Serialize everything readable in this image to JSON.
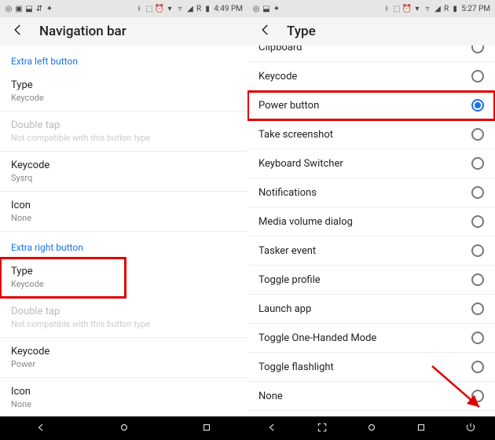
{
  "left": {
    "status": {
      "time": "4:49 PM",
      "net": "R"
    },
    "header_title": "Navigation bar",
    "section_extra_left": "Extra left button",
    "type": {
      "title": "Type",
      "sub": "Keycode"
    },
    "double_tap": {
      "title": "Double tap",
      "sub": "Not compatible with this button type"
    },
    "keycode_left": {
      "title": "Keycode",
      "sub": "Sysrq"
    },
    "icon_left": {
      "title": "Icon",
      "sub": "None"
    },
    "section_extra_right": "Extra right button",
    "type_right": {
      "title": "Type",
      "sub": "Keycode"
    },
    "double_tap_right": {
      "title": "Double tap",
      "sub": "Not compatible with this button type"
    },
    "keycode_right": {
      "title": "Keycode",
      "sub": "Power"
    },
    "icon_right": {
      "title": "Icon",
      "sub": "None"
    }
  },
  "right": {
    "status": {
      "time": "5:27 PM",
      "net": "R"
    },
    "header_title": "Type",
    "clipped_option": "Clipboard",
    "options": [
      {
        "label": "Keycode",
        "selected": false
      },
      {
        "label": "Power button",
        "selected": true,
        "highlight": true
      },
      {
        "label": "Take screenshot",
        "selected": false
      },
      {
        "label": "Keyboard Switcher",
        "selected": false
      },
      {
        "label": "Notifications",
        "selected": false
      },
      {
        "label": "Media volume dialog",
        "selected": false
      },
      {
        "label": "Tasker event",
        "selected": false
      },
      {
        "label": "Toggle profile",
        "selected": false
      },
      {
        "label": "Launch app",
        "selected": false
      },
      {
        "label": "Toggle One-Handed Mode",
        "selected": false
      },
      {
        "label": "Toggle flashlight",
        "selected": false
      },
      {
        "label": "None",
        "selected": false
      }
    ]
  }
}
